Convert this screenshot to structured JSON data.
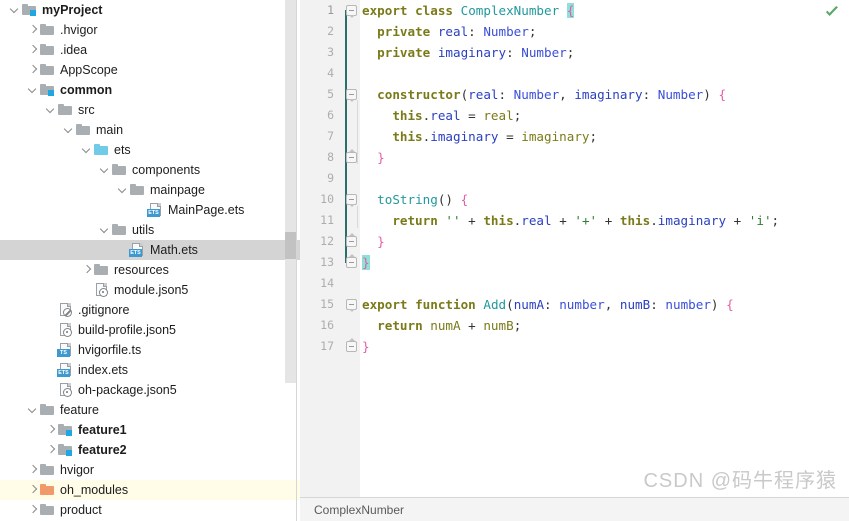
{
  "project_tree": {
    "name": "project-tree",
    "rows": [
      {
        "label": "myProject",
        "indent": 0,
        "twisty": "open",
        "icon": "folder-module",
        "bold": true,
        "state": "normal"
      },
      {
        "label": ".hvigor",
        "indent": 1,
        "twisty": "closed",
        "icon": "folder",
        "bold": false,
        "state": "normal"
      },
      {
        "label": ".idea",
        "indent": 1,
        "twisty": "closed",
        "icon": "folder",
        "bold": false,
        "state": "normal"
      },
      {
        "label": "AppScope",
        "indent": 1,
        "twisty": "closed",
        "icon": "folder",
        "bold": false,
        "state": "normal"
      },
      {
        "label": "common",
        "indent": 1,
        "twisty": "open",
        "icon": "folder-module",
        "bold": true,
        "state": "normal"
      },
      {
        "label": "src",
        "indent": 2,
        "twisty": "open",
        "icon": "folder",
        "bold": false,
        "state": "normal"
      },
      {
        "label": "main",
        "indent": 3,
        "twisty": "open",
        "icon": "folder",
        "bold": false,
        "state": "normal"
      },
      {
        "label": "ets",
        "indent": 4,
        "twisty": "open",
        "icon": "folder-cyan",
        "bold": false,
        "state": "normal"
      },
      {
        "label": "components",
        "indent": 5,
        "twisty": "open",
        "icon": "folder",
        "bold": false,
        "state": "normal"
      },
      {
        "label": "mainpage",
        "indent": 6,
        "twisty": "open",
        "icon": "folder",
        "bold": false,
        "state": "normal"
      },
      {
        "label": "MainPage.ets",
        "indent": 7,
        "twisty": "none",
        "icon": "file-ets",
        "bold": false,
        "state": "normal"
      },
      {
        "label": "utils",
        "indent": 5,
        "twisty": "open",
        "icon": "folder",
        "bold": false,
        "state": "normal"
      },
      {
        "label": "Math.ets",
        "indent": 6,
        "twisty": "none",
        "icon": "file-ets",
        "bold": false,
        "state": "selected"
      },
      {
        "label": "resources",
        "indent": 4,
        "twisty": "closed",
        "icon": "folder",
        "bold": false,
        "state": "normal"
      },
      {
        "label": "module.json5",
        "indent": 4,
        "twisty": "none",
        "icon": "file-json5",
        "bold": false,
        "state": "normal"
      },
      {
        "label": ".gitignore",
        "indent": 2,
        "twisty": "none",
        "icon": "file-gitignore",
        "bold": false,
        "state": "normal"
      },
      {
        "label": "build-profile.json5",
        "indent": 2,
        "twisty": "none",
        "icon": "file-json5",
        "bold": false,
        "state": "normal"
      },
      {
        "label": "hvigorfile.ts",
        "indent": 2,
        "twisty": "none",
        "icon": "file-ts",
        "bold": false,
        "state": "normal"
      },
      {
        "label": "index.ets",
        "indent": 2,
        "twisty": "none",
        "icon": "file-ets",
        "bold": false,
        "state": "normal"
      },
      {
        "label": "oh-package.json5",
        "indent": 2,
        "twisty": "none",
        "icon": "file-json5",
        "bold": false,
        "state": "normal"
      },
      {
        "label": "feature",
        "indent": 1,
        "twisty": "open",
        "icon": "folder",
        "bold": false,
        "state": "normal"
      },
      {
        "label": "feature1",
        "indent": 2,
        "twisty": "closed",
        "icon": "folder-module",
        "bold": true,
        "state": "normal"
      },
      {
        "label": "feature2",
        "indent": 2,
        "twisty": "closed",
        "icon": "folder-module",
        "bold": true,
        "state": "normal"
      },
      {
        "label": "hvigor",
        "indent": 1,
        "twisty": "closed",
        "icon": "folder",
        "bold": false,
        "state": "normal"
      },
      {
        "label": "oh_modules",
        "indent": 1,
        "twisty": "closed",
        "icon": "folder-orange",
        "bold": false,
        "state": "highlighted"
      },
      {
        "label": "product",
        "indent": 1,
        "twisty": "closed",
        "icon": "folder",
        "bold": false,
        "state": "normal"
      }
    ]
  },
  "editor": {
    "current_line": 1,
    "line_numbers": [
      "1",
      "2",
      "3",
      "4",
      "5",
      "6",
      "7",
      "8",
      "9",
      "10",
      "11",
      "12",
      "13",
      "14",
      "15",
      "16",
      "17"
    ],
    "lines": [
      {
        "n": 1,
        "indent": 0,
        "tokens": [
          {
            "t": "export",
            "c": "kw"
          },
          {
            "t": " ",
            "c": "pun"
          },
          {
            "t": "class",
            "c": "kw"
          },
          {
            "t": " ",
            "c": "pun"
          },
          {
            "t": "ComplexNumber",
            "c": "typ"
          },
          {
            "t": " ",
            "c": "pun"
          },
          {
            "t": "{",
            "c": "brc-hl"
          }
        ]
      },
      {
        "n": 2,
        "indent": 1,
        "tokens": [
          {
            "t": "private",
            "c": "kw"
          },
          {
            "t": " ",
            "c": "pun"
          },
          {
            "t": "real",
            "c": "fld"
          },
          {
            "t": ": ",
            "c": "pun"
          },
          {
            "t": "Number",
            "c": "bi"
          },
          {
            "t": ";",
            "c": "pun"
          }
        ]
      },
      {
        "n": 3,
        "indent": 1,
        "tokens": [
          {
            "t": "private",
            "c": "kw"
          },
          {
            "t": " ",
            "c": "pun"
          },
          {
            "t": "imaginary",
            "c": "fld"
          },
          {
            "t": ": ",
            "c": "pun"
          },
          {
            "t": "Number",
            "c": "bi"
          },
          {
            "t": ";",
            "c": "pun"
          }
        ]
      },
      {
        "n": 4,
        "indent": 0,
        "tokens": []
      },
      {
        "n": 5,
        "indent": 1,
        "tokens": [
          {
            "t": "constructor",
            "c": "kw"
          },
          {
            "t": "(",
            "c": "pun"
          },
          {
            "t": "real",
            "c": "fld"
          },
          {
            "t": ": ",
            "c": "pun"
          },
          {
            "t": "Number",
            "c": "bi"
          },
          {
            "t": ", ",
            "c": "pun"
          },
          {
            "t": "imaginary",
            "c": "fld"
          },
          {
            "t": ": ",
            "c": "pun"
          },
          {
            "t": "Number",
            "c": "bi"
          },
          {
            "t": ") ",
            "c": "pun"
          },
          {
            "t": "{",
            "c": "brc"
          }
        ]
      },
      {
        "n": 6,
        "indent": 2,
        "tokens": [
          {
            "t": "this",
            "c": "kw"
          },
          {
            "t": ".",
            "c": "pun"
          },
          {
            "t": "real",
            "c": "fld"
          },
          {
            "t": " = ",
            "c": "pun"
          },
          {
            "t": "real",
            "c": "kwb"
          },
          {
            "t": ";",
            "c": "pun"
          }
        ]
      },
      {
        "n": 7,
        "indent": 2,
        "tokens": [
          {
            "t": "this",
            "c": "kw"
          },
          {
            "t": ".",
            "c": "pun"
          },
          {
            "t": "imaginary",
            "c": "fld"
          },
          {
            "t": " = ",
            "c": "pun"
          },
          {
            "t": "imaginary",
            "c": "kwb"
          },
          {
            "t": ";",
            "c": "pun"
          }
        ]
      },
      {
        "n": 8,
        "indent": 1,
        "tokens": [
          {
            "t": "}",
            "c": "brc"
          }
        ]
      },
      {
        "n": 9,
        "indent": 0,
        "tokens": []
      },
      {
        "n": 10,
        "indent": 1,
        "tokens": [
          {
            "t": "toString",
            "c": "typ"
          },
          {
            "t": "() ",
            "c": "pun"
          },
          {
            "t": "{",
            "c": "brc"
          }
        ]
      },
      {
        "n": 11,
        "indent": 2,
        "tokens": [
          {
            "t": "return",
            "c": "kw"
          },
          {
            "t": " ",
            "c": "pun"
          },
          {
            "t": "''",
            "c": "str"
          },
          {
            "t": " + ",
            "c": "pun"
          },
          {
            "t": "this",
            "c": "kw"
          },
          {
            "t": ".",
            "c": "pun"
          },
          {
            "t": "real",
            "c": "fld"
          },
          {
            "t": " + ",
            "c": "pun"
          },
          {
            "t": "'+'",
            "c": "str"
          },
          {
            "t": " + ",
            "c": "pun"
          },
          {
            "t": "this",
            "c": "kw"
          },
          {
            "t": ".",
            "c": "pun"
          },
          {
            "t": "imaginary",
            "c": "fld"
          },
          {
            "t": " + ",
            "c": "pun"
          },
          {
            "t": "'i'",
            "c": "str"
          },
          {
            "t": ";",
            "c": "pun"
          }
        ]
      },
      {
        "n": 12,
        "indent": 1,
        "tokens": [
          {
            "t": "}",
            "c": "brc"
          }
        ]
      },
      {
        "n": 13,
        "indent": 0,
        "tokens": [
          {
            "t": "}",
            "c": "brc-hl"
          }
        ]
      },
      {
        "n": 14,
        "indent": 0,
        "tokens": []
      },
      {
        "n": 15,
        "indent": 0,
        "tokens": [
          {
            "t": "export",
            "c": "kw"
          },
          {
            "t": " ",
            "c": "pun"
          },
          {
            "t": "function",
            "c": "kw"
          },
          {
            "t": " ",
            "c": "pun"
          },
          {
            "t": "Add",
            "c": "typ"
          },
          {
            "t": "(",
            "c": "pun"
          },
          {
            "t": "numA",
            "c": "fld"
          },
          {
            "t": ": ",
            "c": "pun"
          },
          {
            "t": "number",
            "c": "bi"
          },
          {
            "t": ", ",
            "c": "pun"
          },
          {
            "t": "numB",
            "c": "fld"
          },
          {
            "t": ": ",
            "c": "pun"
          },
          {
            "t": "number",
            "c": "bi"
          },
          {
            "t": ") ",
            "c": "pun"
          },
          {
            "t": "{",
            "c": "brc"
          }
        ]
      },
      {
        "n": 16,
        "indent": 1,
        "tokens": [
          {
            "t": "return",
            "c": "kw"
          },
          {
            "t": " ",
            "c": "pun"
          },
          {
            "t": "numA",
            "c": "kwb"
          },
          {
            "t": " + ",
            "c": "pun"
          },
          {
            "t": "numB",
            "c": "kwb"
          },
          {
            "t": ";",
            "c": "pun"
          }
        ]
      },
      {
        "n": 17,
        "indent": 0,
        "tokens": [
          {
            "t": "}",
            "c": "brc"
          }
        ]
      }
    ],
    "fold_markers": [
      {
        "line": 1,
        "type": "tip"
      },
      {
        "line": 5,
        "type": "tip"
      },
      {
        "line": 8,
        "type": "end"
      },
      {
        "line": 10,
        "type": "tip"
      },
      {
        "line": 12,
        "type": "end"
      },
      {
        "line": 13,
        "type": "end"
      },
      {
        "line": 15,
        "type": "tip"
      },
      {
        "line": 17,
        "type": "end"
      }
    ],
    "inspection_icon": "checkmark-icon",
    "inspection_status": "no-problems"
  },
  "status_bar": {
    "breadcrumb": "ComplexNumber"
  },
  "watermark": {
    "text": "CSDN @码牛程序猿"
  },
  "colors": {
    "selection": "#d4d4d4",
    "row_highlight": "#fffde7",
    "current_line": "#fdf9e8",
    "gutter_bg": "#f2f2f2",
    "keyword": "#7a7a19",
    "type": "#20999d",
    "builtin_type": "#3a4fd8",
    "field": "#2a3fc0",
    "brace": "#e05fa8",
    "string": "#2e7d32",
    "brace_match_bg": "#8fe0d8",
    "scope_line": "#2b6e6a",
    "module_badge": "#1ea7e0",
    "folder_gray": "#a9aeb2",
    "folder_orange": "#f2996b",
    "folder_cyan": "#6fcbe8",
    "inspection_green": "#59a869"
  }
}
